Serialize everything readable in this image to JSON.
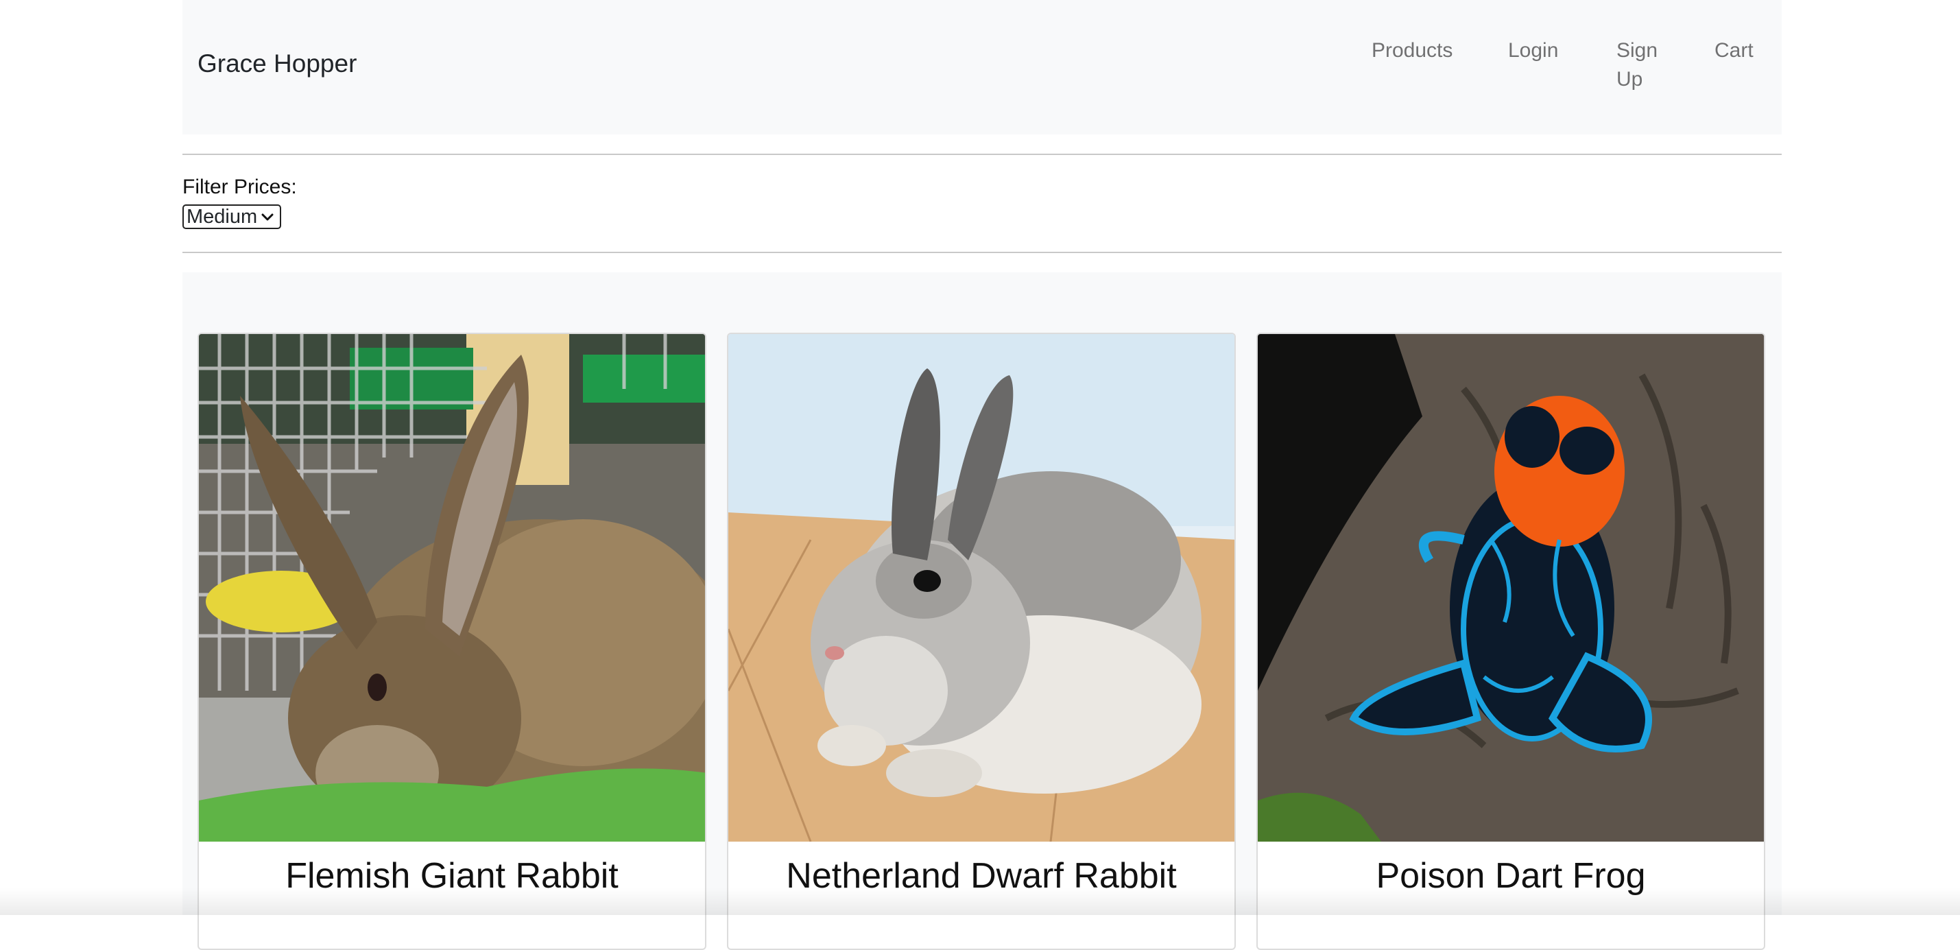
{
  "navbar": {
    "brand": "Grace Hopper",
    "links": {
      "products": "Products",
      "login": "Login",
      "signup": "Sign Up",
      "cart": "Cart"
    }
  },
  "filter": {
    "label": "Filter Prices:",
    "selected": "Medium"
  },
  "products": [
    {
      "title": "Flemish Giant Rabbit"
    },
    {
      "title": "Netherland Dwarf Rabbit"
    },
    {
      "title": "Poison Dart Frog"
    }
  ],
  "colors": {
    "navbar_bg": "#f8f9fa",
    "frog_orange": "#f25c12",
    "frog_blue": "#1aa3e0"
  }
}
